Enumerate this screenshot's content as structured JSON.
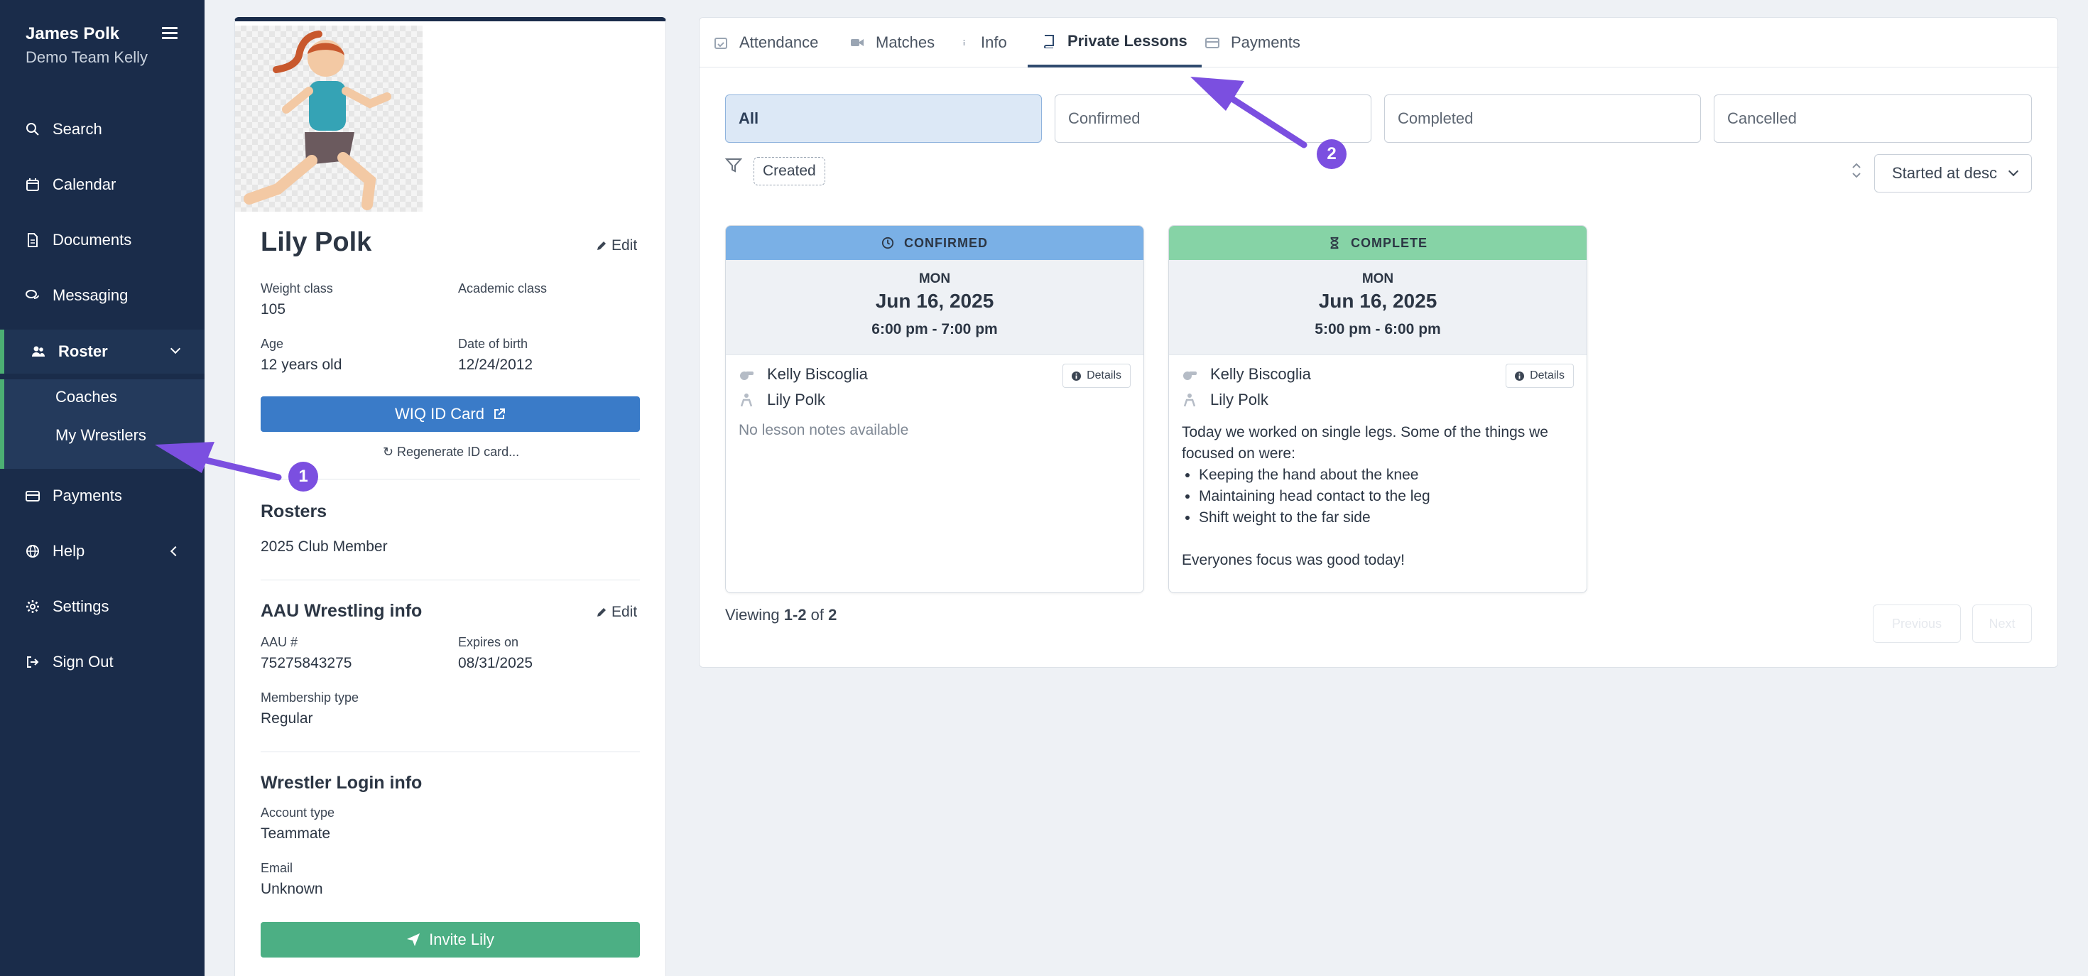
{
  "sidebar": {
    "user_name": "James Polk",
    "team_name": "Demo Team Kelly",
    "items": [
      {
        "label": "Search",
        "icon": "search-icon"
      },
      {
        "label": "Calendar",
        "icon": "calendar-icon"
      },
      {
        "label": "Documents",
        "icon": "document-icon"
      },
      {
        "label": "Messaging",
        "icon": "messaging-icon"
      },
      {
        "label": "Roster",
        "icon": "users-icon"
      },
      {
        "label": "Payments",
        "icon": "credit-card-icon"
      },
      {
        "label": "Help",
        "icon": "globe-icon"
      },
      {
        "label": "Settings",
        "icon": "gear-icon"
      },
      {
        "label": "Sign Out",
        "icon": "sign-out-icon"
      }
    ],
    "roster_sub": [
      "Coaches",
      "My Wrestlers"
    ]
  },
  "profile": {
    "name": "Lily Polk",
    "edit_label": "Edit",
    "weight_class_label": "Weight class",
    "weight_class": "105",
    "academic_class_label": "Academic class",
    "academic_class": "",
    "age_label": "Age",
    "age": "12 years old",
    "dob_label": "Date of birth",
    "dob": "12/24/2012",
    "id_card_label": "WIQ ID Card",
    "regen_label": "Regenerate ID card...",
    "rosters_title": "Rosters",
    "roster_value": "2025 Club Member",
    "aau_title": "AAU Wrestling info",
    "aau_num_label": "AAU #",
    "aau_num": "75275843275",
    "expires_label": "Expires on",
    "expires": "08/31/2025",
    "membership_label": "Membership type",
    "membership": "Regular",
    "login_title": "Wrestler Login info",
    "account_type_label": "Account type",
    "account_type": "Teammate",
    "email_label": "Email",
    "email": "Unknown",
    "invite_label": "Invite Lily"
  },
  "tabs": [
    {
      "label": "Attendance",
      "icon": "calendar-check-icon"
    },
    {
      "label": "Matches",
      "icon": "video-icon"
    },
    {
      "label": "Info",
      "icon": "info-icon"
    },
    {
      "label": "Private Lessons",
      "icon": "book-icon",
      "active": true
    },
    {
      "label": "Payments",
      "icon": "credit-card-icon"
    }
  ],
  "filters": [
    "All",
    "Confirmed",
    "Completed",
    "Cancelled"
  ],
  "filter_chip": "Created",
  "sort_value": "Started at desc",
  "lessons": [
    {
      "status": "CONFIRMED",
      "status_color": "#7ab0e6",
      "dow": "MON",
      "date": "Jun 16, 2025",
      "time": "6:00 pm - 7:00 pm",
      "coach": "Kelly Biscoglia",
      "wrestler": "Lily Polk",
      "details_label": "Details",
      "notes_empty": "No lesson notes available"
    },
    {
      "status": "COMPLETE",
      "status_color": "#86d3a6",
      "dow": "MON",
      "date": "Jun 16, 2025",
      "time": "5:00 pm - 6:00 pm",
      "coach": "Kelly Biscoglia",
      "wrestler": "Lily Polk",
      "details_label": "Details",
      "notes_intro": "Today we worked on single legs. Some of the things we focused on were:",
      "notes_points": [
        "Keeping the hand about the knee",
        "Maintaining head contact to the leg",
        "Shift weight to the far side"
      ],
      "notes_outro": "Everyones focus was good today!"
    }
  ],
  "viewing": {
    "prefix": "Viewing ",
    "range": "1-2",
    "of": " of ",
    "total": "2"
  },
  "pager": {
    "prev": "Previous",
    "next": "Next"
  },
  "annotations": [
    {
      "label": "1"
    },
    {
      "label": "2"
    }
  ],
  "colors": {
    "sidebar": "#1a2c4a",
    "accent_green": "#4caf84",
    "accent_blue": "#3a7bc8",
    "annotation": "#7b4fe0"
  }
}
